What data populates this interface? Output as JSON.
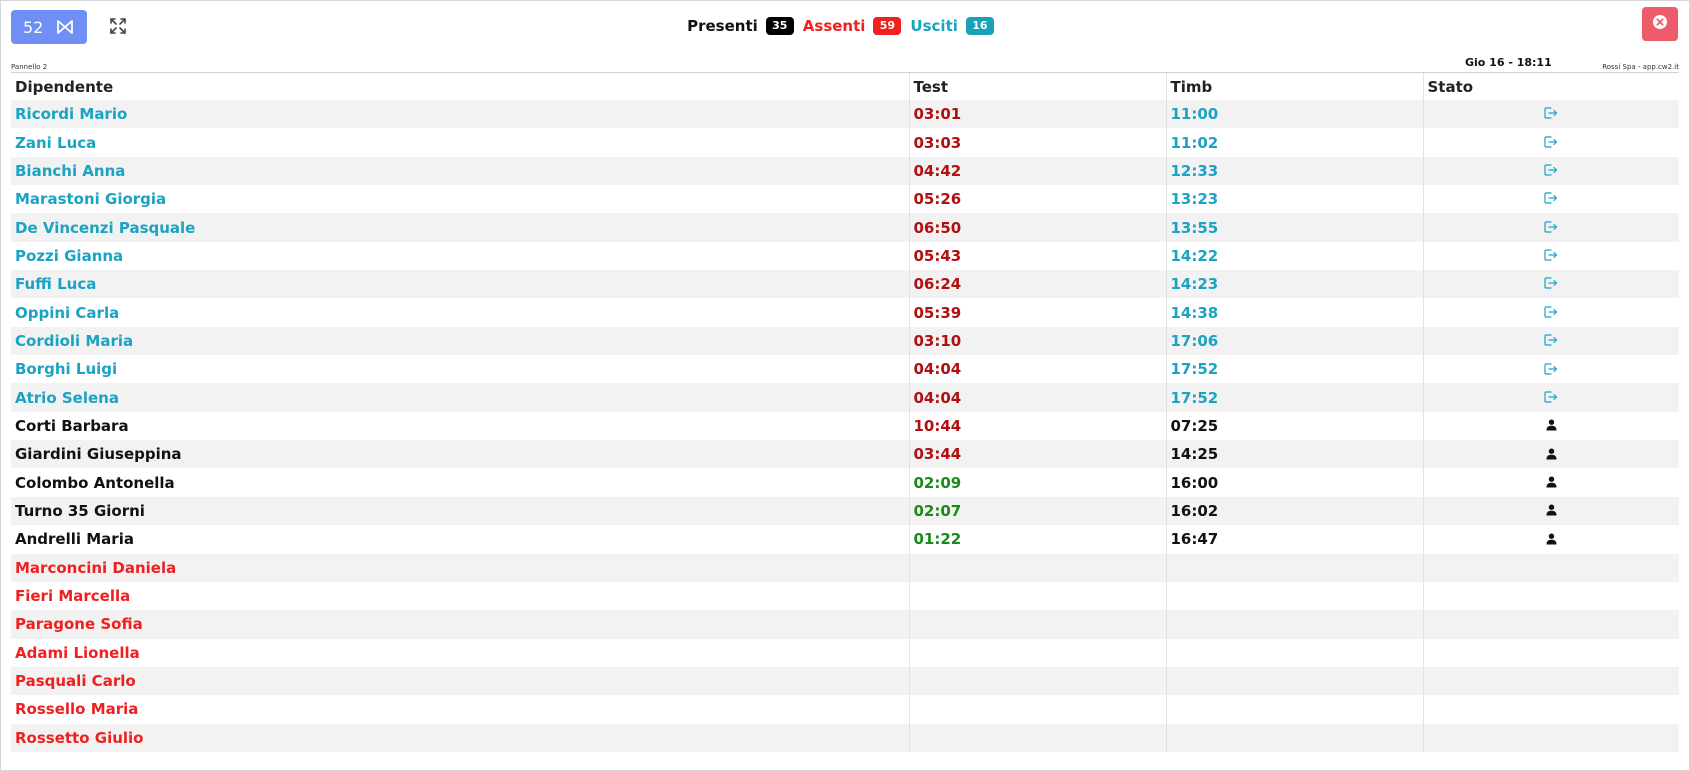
{
  "header": {
    "panel_number": "52",
    "counters": [
      {
        "label": "Presenti",
        "count": "35",
        "label_color": "#111111",
        "badge_color": "#000000"
      },
      {
        "label": "Assenti",
        "count": "59",
        "label_color": "#f02020",
        "badge_color": "#f02020"
      },
      {
        "label": "Usciti",
        "count": "16",
        "label_color": "#1aa3c3",
        "badge_color": "#17a2b8"
      }
    ],
    "panel_name": "Pannello 2",
    "datetime": "Gio 16 - 18:11",
    "company": "Rossi Spa - app.cw2.it"
  },
  "table": {
    "columns": [
      "Dipendente",
      "Test",
      "Timb",
      "Stato"
    ],
    "rows": [
      {
        "name": "Ricordi Mario",
        "test": "03:01",
        "timb": "11:00",
        "state": "out",
        "test_color": "red"
      },
      {
        "name": "Zani Luca",
        "test": "03:03",
        "timb": "11:02",
        "state": "out",
        "test_color": "red"
      },
      {
        "name": "Bianchi Anna",
        "test": "04:42",
        "timb": "12:33",
        "state": "out",
        "test_color": "red"
      },
      {
        "name": "Marastoni Giorgia",
        "test": "05:26",
        "timb": "13:23",
        "state": "out",
        "test_color": "red"
      },
      {
        "name": "De Vincenzi Pasquale",
        "test": "06:50",
        "timb": "13:55",
        "state": "out",
        "test_color": "red"
      },
      {
        "name": "Pozzi Gianna",
        "test": "05:43",
        "timb": "14:22",
        "state": "out",
        "test_color": "red"
      },
      {
        "name": "Fuffi Luca",
        "test": "06:24",
        "timb": "14:23",
        "state": "out",
        "test_color": "red"
      },
      {
        "name": "Oppini Carla",
        "test": "05:39",
        "timb": "14:38",
        "state": "out",
        "test_color": "red"
      },
      {
        "name": "Cordioli Maria",
        "test": "03:10",
        "timb": "17:06",
        "state": "out",
        "test_color": "red"
      },
      {
        "name": "Borghi Luigi",
        "test": "04:04",
        "timb": "17:52",
        "state": "out",
        "test_color": "red"
      },
      {
        "name": "Atrio Selena",
        "test": "04:04",
        "timb": "17:52",
        "state": "out",
        "test_color": "red"
      },
      {
        "name": "Corti Barbara",
        "test": "10:44",
        "timb": "07:25",
        "state": "in",
        "test_color": "red"
      },
      {
        "name": "Giardini Giuseppina",
        "test": "03:44",
        "timb": "14:25",
        "state": "in",
        "test_color": "red"
      },
      {
        "name": "Colombo Antonella",
        "test": "02:09",
        "timb": "16:00",
        "state": "in",
        "test_color": "green"
      },
      {
        "name": "Turno 35 Giorni",
        "test": "02:07",
        "timb": "16:02",
        "state": "in",
        "test_color": "green"
      },
      {
        "name": "Andrelli Maria",
        "test": "01:22",
        "timb": "16:47",
        "state": "in",
        "test_color": "green"
      },
      {
        "name": "Marconcini Daniela",
        "test": "",
        "timb": "",
        "state": "absent",
        "test_color": ""
      },
      {
        "name": "Fieri Marcella",
        "test": "",
        "timb": "",
        "state": "absent",
        "test_color": ""
      },
      {
        "name": "Paragone Sofia",
        "test": "",
        "timb": "",
        "state": "absent",
        "test_color": ""
      },
      {
        "name": "Adami Lionella",
        "test": "",
        "timb": "",
        "state": "absent",
        "test_color": ""
      },
      {
        "name": "Pasquali Carlo",
        "test": "",
        "timb": "",
        "state": "absent",
        "test_color": ""
      },
      {
        "name": "Rossello Maria",
        "test": "",
        "timb": "",
        "state": "absent",
        "test_color": ""
      },
      {
        "name": "Rossetto Giulio",
        "test": "",
        "timb": "",
        "state": "absent",
        "test_color": ""
      }
    ]
  },
  "icons": {
    "panel_button": "bowtie-icon",
    "fullscreen": "expand-icon",
    "close": "close-circle-icon",
    "out_state": "exit-door-icon",
    "in_state": "person-icon"
  }
}
